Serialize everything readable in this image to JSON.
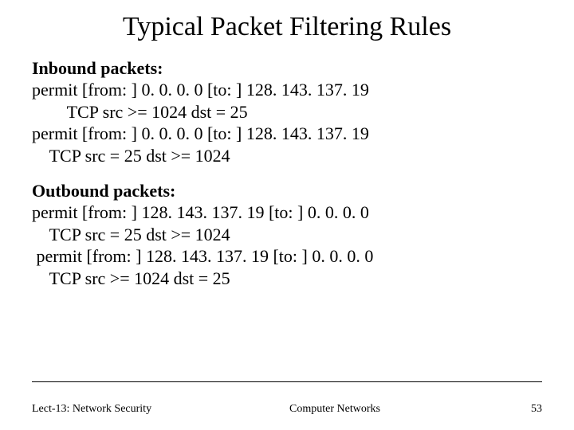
{
  "title": "Typical Packet Filtering Rules",
  "inbound": {
    "heading": "Inbound packets:",
    "line1": "permit [from: ] 0. 0. 0. 0 [to: ] 128. 143. 137. 19",
    "line2": "        TCP src >= 1024 dst = 25",
    "line3": "permit [from: ] 0. 0. 0. 0 [to: ] 128. 143. 137. 19",
    "line4": "    TCP src = 25 dst >= 1024"
  },
  "outbound": {
    "heading": "Outbound packets:",
    "line1": "permit [from: ] 128. 143. 137. 19 [to: ] 0. 0. 0. 0",
    "line2": "    TCP src = 25 dst >= 1024",
    "line3": " permit [from: ] 128. 143. 137. 19 [to: ] 0. 0. 0. 0",
    "line4": "    TCP src >= 1024 dst = 25"
  },
  "footer": {
    "left": "Lect-13: Network Security",
    "center": "Computer Networks",
    "right": "53"
  }
}
